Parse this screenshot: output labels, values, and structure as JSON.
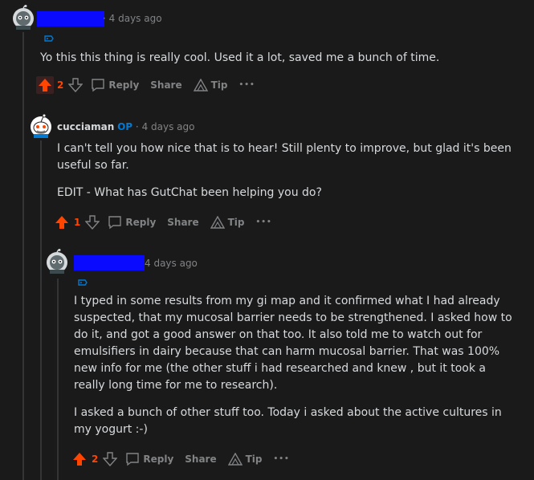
{
  "comments": [
    {
      "author_hidden": true,
      "time": "4 days ago",
      "body": [
        "Yo this this thing is really cool. Used it a lot, saved me a bunch of time."
      ],
      "votes": "2",
      "actions": {
        "reply": "Reply",
        "share": "Share",
        "tip": "Tip",
        "more": "•••"
      }
    },
    {
      "author": "cucciaman",
      "op_badge": "OP",
      "separator": "·",
      "time": "4 days ago",
      "body": [
        "I can't tell you how nice that is to hear! Still plenty to improve, but glad it's been useful so far.",
        "EDIT - What has GutChat been helping you do?"
      ],
      "votes": "1",
      "actions": {
        "reply": "Reply",
        "share": "Share",
        "tip": "Tip",
        "more": "•••"
      }
    },
    {
      "author_hidden": true,
      "time": "4 days ago",
      "body": [
        "I typed in some results from my gi map and it confirmed what I had already suspected, that my mucosal barrier needs to be strengthened. I asked how to do it, and got a good answer on that too. It also told me to watch out for emulsifiers in dairy because that can harm mucosal barrier. That was 100% new info for me (the other stuff i had researched and knew , but it took a really long time for me to research).",
        "I asked a bunch of other stuff too. Today i asked about the active cultures in my yogurt :-)"
      ],
      "votes": "2",
      "actions": {
        "reply": "Reply",
        "share": "Share",
        "tip": "Tip",
        "more": "•••"
      }
    }
  ],
  "colors": {
    "upvote": "#ff4500",
    "op": "#0079d3",
    "redaction": "#0a0aff",
    "background": "#1a1a1b"
  }
}
